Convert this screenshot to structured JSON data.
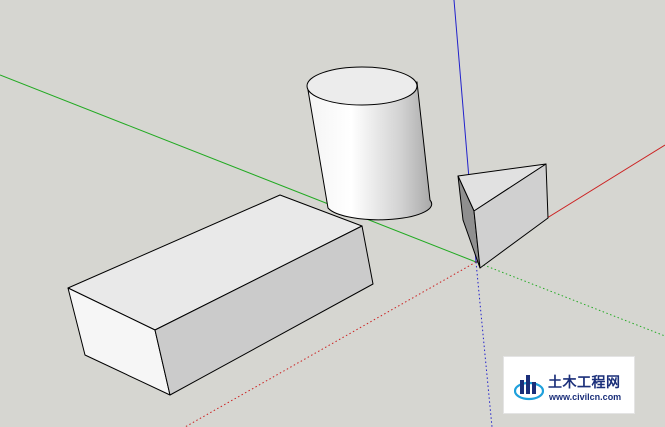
{
  "viewport": {
    "background": "#d6d6d1",
    "axes": {
      "red": "#cc2222",
      "green": "#22aa22",
      "blue": "#2222cc"
    }
  },
  "objects": [
    {
      "name": "box",
      "kind": "rectangular-prism"
    },
    {
      "name": "cylinder",
      "kind": "cylinder"
    },
    {
      "name": "wedge",
      "kind": "triangular-prism"
    }
  ],
  "watermark": {
    "title": "土木工程网",
    "url": "www.civilcn.com",
    "accent": "#1b2f7a",
    "logo_icon": "building-bars-icon"
  }
}
